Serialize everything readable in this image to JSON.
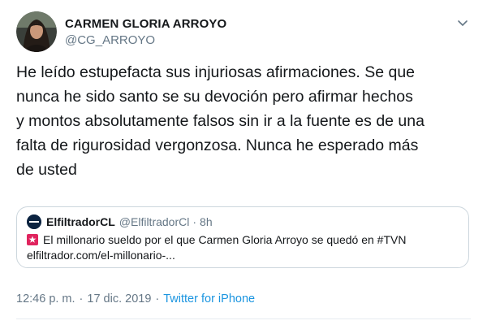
{
  "author": {
    "display_name": "CARMEN GLORIA ARROYO",
    "handle": "@CG_ARROYO",
    "avatar_icon": "profile-photo"
  },
  "tweet": {
    "text": "He leído estupefacta sus injuriosas afirmaciones.  Se que\nnunca he sido santo se su devoción pero afirmar hechos\ny montos absolutamente falsos sin ir a la fuente es de una\nfalta de rigurosidad vergonzosa. Nunca he esperado más\nde usted"
  },
  "quoted_tweet": {
    "display_name": "ElfiltradorCL",
    "handle": "@ElfiltradorCl",
    "separator": "·",
    "time": "8h",
    "headline": "El millonario sueldo por el que Carmen Gloria Arroyo se quedó en #TVN",
    "link": "elfiltrador.com/el-millonario-..."
  },
  "footer": {
    "time": "12:46 p. m.",
    "separator": "·",
    "date": "17 dic. 2019",
    "source": "Twitter for iPhone"
  },
  "colors": {
    "text_primary": "#14171a",
    "text_secondary": "#657786",
    "link": "#1b95e0",
    "border": "#ccd6dd",
    "flag_red": "#e0245e"
  }
}
